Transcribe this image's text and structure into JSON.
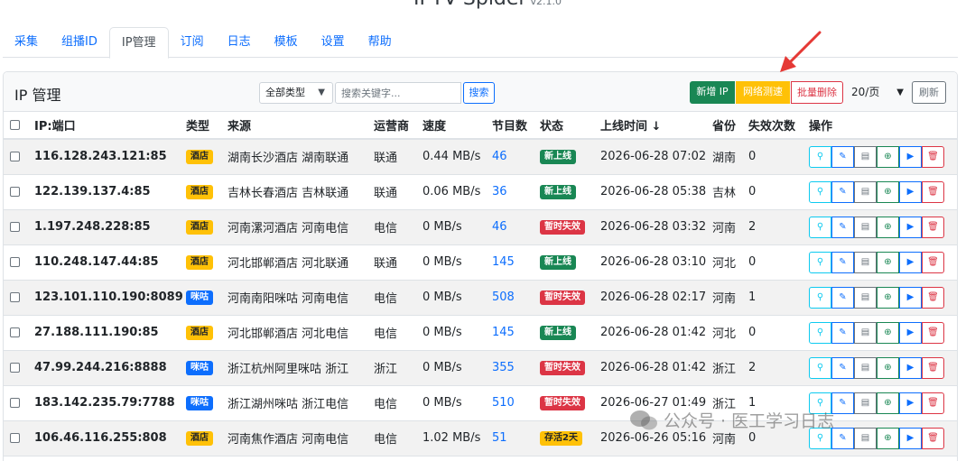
{
  "app": {
    "title": "IPTV-Spider",
    "version": "v2.1.0"
  },
  "tabs": [
    "采集",
    "组播ID",
    "IP管理",
    "订阅",
    "日志",
    "模板",
    "设置",
    "帮助"
  ],
  "active_tab": 2,
  "card": {
    "title": "IP 管理",
    "type_filter": "全部类型",
    "search_placeholder": "搜索关键字...",
    "search_label": "搜索",
    "add_label": "新增 IP",
    "speed_label": "网络测速",
    "bulk_delete_label": "批量删除",
    "page_size": "20/页",
    "refresh_label": "刷新"
  },
  "columns": [
    "IP:端口",
    "类型",
    "来源",
    "运营商",
    "速度",
    "节目数",
    "状态",
    "上线时间 ↓",
    "省份",
    "失效次数",
    "操作"
  ],
  "rows": [
    {
      "ip": "116.128.243.121:85",
      "type": "酒店",
      "type_kind": "hotel",
      "source": "湖南长沙酒店 湖南联通",
      "isp": "联通",
      "speed": "0.44 MB/s",
      "programs": "46",
      "status": "新上线",
      "status_kind": "new",
      "online": "2026-06-28 07:02",
      "province": "湖南",
      "fails": "0"
    },
    {
      "ip": "122.139.137.4:85",
      "type": "酒店",
      "type_kind": "hotel",
      "source": "吉林长春酒店 吉林联通",
      "isp": "联通",
      "speed": "0.06 MB/s",
      "programs": "36",
      "status": "新上线",
      "status_kind": "new",
      "online": "2026-06-28 05:38",
      "province": "吉林",
      "fails": "0"
    },
    {
      "ip": "1.197.248.228:85",
      "type": "酒店",
      "type_kind": "hotel",
      "source": "河南漯河酒店 河南电信",
      "isp": "电信",
      "speed": "0 MB/s",
      "programs": "46",
      "status": "暂时失效",
      "status_kind": "fail",
      "online": "2026-06-28 03:32",
      "province": "河南",
      "fails": "2"
    },
    {
      "ip": "110.248.147.44:85",
      "type": "酒店",
      "type_kind": "hotel",
      "source": "河北邯郸酒店 河北联通",
      "isp": "联通",
      "speed": "0 MB/s",
      "programs": "145",
      "status": "新上线",
      "status_kind": "new",
      "online": "2026-06-28 03:10",
      "province": "河北",
      "fails": "0"
    },
    {
      "ip": "123.101.110.190:8089",
      "type": "咪咕",
      "type_kind": "miga",
      "source": "河南南阳咪咕 河南电信",
      "isp": "电信",
      "speed": "0 MB/s",
      "programs": "508",
      "status": "暂时失效",
      "status_kind": "fail",
      "online": "2026-06-28 02:17",
      "province": "河南",
      "fails": "1"
    },
    {
      "ip": "27.188.111.190:85",
      "type": "酒店",
      "type_kind": "hotel",
      "source": "河北邯郸酒店 河北电信",
      "isp": "电信",
      "speed": "0 MB/s",
      "programs": "145",
      "status": "新上线",
      "status_kind": "new",
      "online": "2026-06-28 01:42",
      "province": "河北",
      "fails": "0"
    },
    {
      "ip": "47.99.244.216:8888",
      "type": "咪咕",
      "type_kind": "miga",
      "source": "浙江杭州阿里咪咕 浙江",
      "isp": "浙江",
      "speed": "0 MB/s",
      "programs": "355",
      "status": "暂时失效",
      "status_kind": "fail",
      "online": "2026-06-28 01:42",
      "province": "浙江",
      "fails": "2"
    },
    {
      "ip": "183.142.235.79:7788",
      "type": "咪咕",
      "type_kind": "miga",
      "source": "浙江湖州咪咕 浙江电信",
      "isp": "电信",
      "speed": "0 MB/s",
      "programs": "510",
      "status": "暂时失效",
      "status_kind": "fail",
      "online": "2026-06-27 01:49",
      "province": "浙江",
      "fails": "1"
    },
    {
      "ip": "106.46.116.255:808",
      "type": "酒店",
      "type_kind": "hotel",
      "source": "河南焦作酒店 河南电信",
      "isp": "电信",
      "speed": "1.02 MB/s",
      "programs": "51",
      "status": "存活2天",
      "status_kind": "alive",
      "online": "2026-06-26 05:16",
      "province": "河南",
      "fails": "0"
    }
  ],
  "actions": [
    {
      "name": "location-icon",
      "kind": "loc"
    },
    {
      "name": "edit-icon",
      "kind": "edit"
    },
    {
      "name": "document-icon",
      "kind": "doc"
    },
    {
      "name": "file-add-icon",
      "kind": "fadd"
    },
    {
      "name": "play-icon",
      "kind": "play"
    },
    {
      "name": "trash-icon",
      "kind": "del"
    }
  ],
  "watermark": "公众号 · 医工学习日志",
  "colors": {
    "primary": "#0d6efd",
    "success": "#198754",
    "warning": "#ffc107",
    "danger": "#dc3545",
    "info": "#0dcaf0",
    "secondary": "#6c757d",
    "arrow": "#e53935"
  }
}
